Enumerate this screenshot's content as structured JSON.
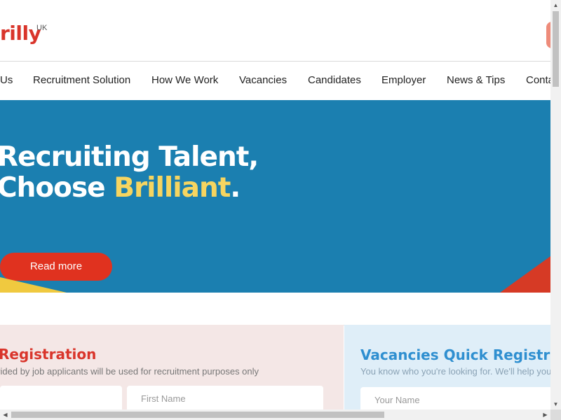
{
  "header": {
    "logo_text": "rilly",
    "logo_region": "UK"
  },
  "nav": {
    "items": [
      {
        "label": "Us"
      },
      {
        "label": "Recruitment Solution"
      },
      {
        "label": "How We Work"
      },
      {
        "label": "Vacancies"
      },
      {
        "label": "Candidates"
      },
      {
        "label": "Employer"
      },
      {
        "label": "News & Tips"
      },
      {
        "label": "Conta"
      }
    ]
  },
  "hero": {
    "title_line1": "Recruiting Talent,",
    "title_line2_prefix": "Choose ",
    "title_line2_accent": "Brilliant",
    "title_line2_suffix": ".",
    "button_label": "Read more",
    "colors": {
      "background": "#1b7fb0",
      "accent": "#f6d560",
      "button": "#e0321f"
    }
  },
  "candidate_registration": {
    "title": "Registration",
    "subtitle": "vided by job applicants will be used for recruitment purposes only",
    "fields": [
      {
        "placeholder": ""
      },
      {
        "placeholder": "First Name"
      }
    ]
  },
  "vacancies_registration": {
    "title": "Vacancies Quick Registra",
    "subtitle": "You know who you're looking for. We'll help you",
    "fields": [
      {
        "placeholder": "Your Name"
      }
    ]
  },
  "scrollbars": {
    "vertical_up_icon": "triangle-up-icon",
    "vertical_down_icon": "triangle-down-icon",
    "horizontal_left_icon": "triangle-left-icon",
    "horizontal_right_icon": "triangle-right-icon"
  }
}
